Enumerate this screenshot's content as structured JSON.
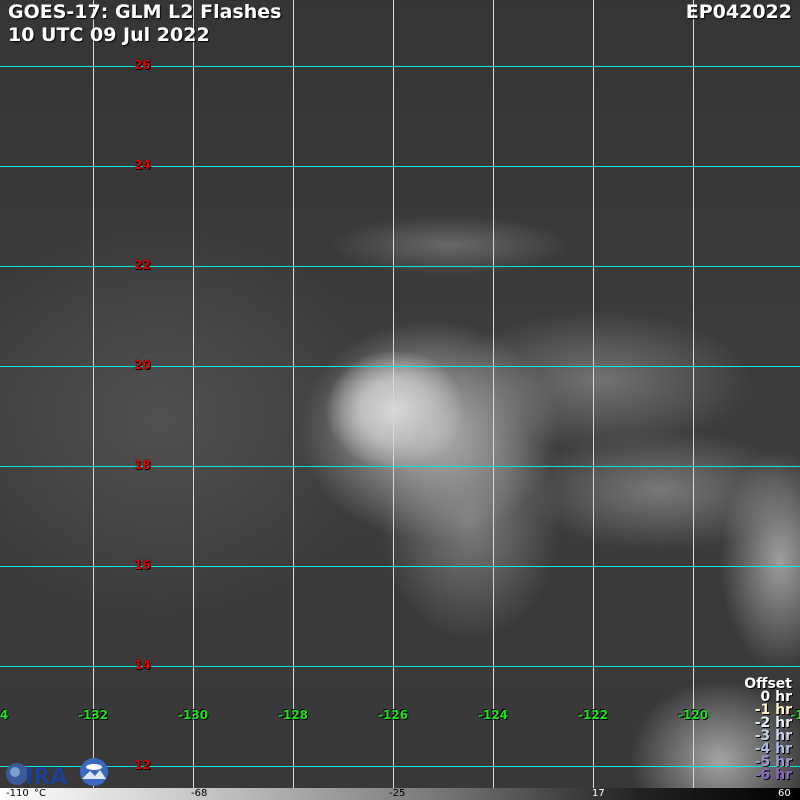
{
  "header": {
    "title": "GOES-17: GLM L2 Flashes",
    "datetime": "10 UTC 09 Jul 2022",
    "storm_id": "EP042022"
  },
  "grid": {
    "lat_labels": [
      "26",
      "24",
      "22",
      "20",
      "18",
      "16",
      "14",
      "12"
    ],
    "lon_labels": [
      "4",
      "-132",
      "-130",
      "-128",
      "-126",
      "-124",
      "-122",
      "-120",
      "-1"
    ]
  },
  "offset_legend": {
    "title": "Offset",
    "items": [
      {
        "label": "0 hr",
        "color": "#ffffff"
      },
      {
        "label": "-1 hr",
        "color": "#fff5c8"
      },
      {
        "label": "-2 hr",
        "color": "#e6ecf5"
      },
      {
        "label": "-3 hr",
        "color": "#c8d4ea"
      },
      {
        "label": "-4 hr",
        "color": "#aabce0"
      },
      {
        "label": "-5 hr",
        "color": "#9a98d0"
      },
      {
        "label": "-6 hr",
        "color": "#8a6ac0"
      }
    ]
  },
  "colorbar": {
    "labels": [
      "-110",
      "°C",
      "-68",
      "-25",
      "17",
      "60"
    ]
  },
  "logo": {
    "text": "CIRA"
  }
}
